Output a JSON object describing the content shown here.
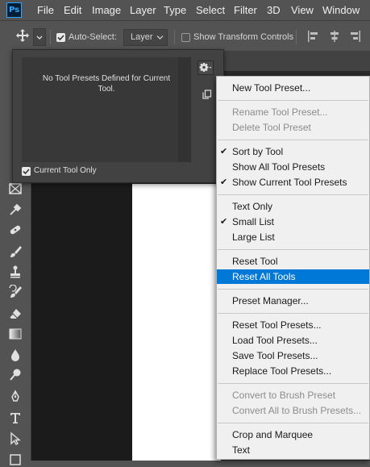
{
  "app": {
    "logo": "Ps"
  },
  "menubar": {
    "items": [
      "File",
      "Edit",
      "Image",
      "Layer",
      "Type",
      "Select",
      "Filter",
      "3D",
      "View",
      "Window"
    ]
  },
  "options_bar": {
    "auto_select_label": "Auto-Select:",
    "auto_select_checked": true,
    "auto_select_target": "Layer",
    "show_transform_label": "Show Transform Controls",
    "show_transform_checked": false
  },
  "tool_presets_panel": {
    "empty_message": "No Tool Presets Defined for Current Tool.",
    "current_tool_only_label": "Current Tool Only",
    "current_tool_only_checked": true
  },
  "flyout_menu": {
    "groups": [
      [
        {
          "label": "New Tool Preset...",
          "enabled": true,
          "checked": false
        }
      ],
      [
        {
          "label": "Rename Tool Preset...",
          "enabled": false,
          "checked": false
        },
        {
          "label": "Delete Tool Preset",
          "enabled": false,
          "checked": false
        }
      ],
      [
        {
          "label": "Sort by Tool",
          "enabled": true,
          "checked": true
        },
        {
          "label": "Show All Tool Presets",
          "enabled": true,
          "checked": false
        },
        {
          "label": "Show Current Tool Presets",
          "enabled": true,
          "checked": true
        }
      ],
      [
        {
          "label": "Text Only",
          "enabled": true,
          "checked": false
        },
        {
          "label": "Small List",
          "enabled": true,
          "checked": true
        },
        {
          "label": "Large List",
          "enabled": true,
          "checked": false
        }
      ],
      [
        {
          "label": "Reset Tool",
          "enabled": true,
          "checked": false
        },
        {
          "label": "Reset All Tools",
          "enabled": true,
          "checked": false,
          "highlighted": true
        }
      ],
      [
        {
          "label": "Preset Manager...",
          "enabled": true,
          "checked": false
        }
      ],
      [
        {
          "label": "Reset Tool Presets...",
          "enabled": true,
          "checked": false
        },
        {
          "label": "Load Tool Presets...",
          "enabled": true,
          "checked": false
        },
        {
          "label": "Save Tool Presets...",
          "enabled": true,
          "checked": false
        },
        {
          "label": "Replace Tool Presets...",
          "enabled": true,
          "checked": false
        }
      ],
      [
        {
          "label": "Convert to Brush Preset",
          "enabled": false,
          "checked": false
        },
        {
          "label": "Convert All to Brush Presets...",
          "enabled": false,
          "checked": false
        }
      ],
      [
        {
          "label": "Crop and Marquee",
          "enabled": true,
          "checked": false
        },
        {
          "label": "Text",
          "enabled": true,
          "checked": false
        }
      ]
    ],
    "check_glyph": "✔"
  },
  "toolbar": {
    "tools": [
      "frame-tool-icon",
      "eyedropper-tool-icon",
      "healing-brush-tool-icon",
      "brush-tool-icon",
      "clone-stamp-tool-icon",
      "history-brush-tool-icon",
      "eraser-tool-icon",
      "gradient-tool-icon",
      "blur-tool-icon",
      "dodge-tool-icon",
      "pen-tool-icon",
      "type-tool-icon",
      "path-selection-tool-icon",
      "rectangle-tool-icon"
    ]
  },
  "colors": {
    "ui_dark": "#535353",
    "panel": "#424242",
    "menu_bg": "#f0f0f0",
    "menu_highlight": "#0078d7",
    "ps_blue": "#31a8ff"
  }
}
